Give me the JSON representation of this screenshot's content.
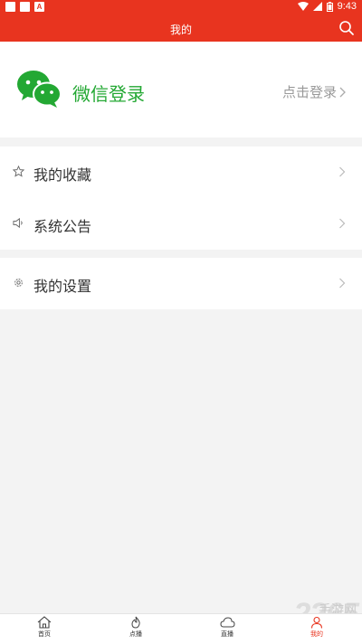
{
  "status_bar": {
    "time": "9:43",
    "notif_badge": "A"
  },
  "header": {
    "title": "我的"
  },
  "login": {
    "wechat_label": "微信登录",
    "login_link": "点击登录"
  },
  "menu": {
    "favorites": "我的收藏",
    "announcements": "系统公告",
    "settings": "我的设置"
  },
  "tabs": [
    {
      "label": "首页"
    },
    {
      "label": "点播"
    },
    {
      "label": "直播"
    },
    {
      "label": "我的"
    }
  ],
  "watermark": {
    "number": "2265",
    "text": "手游网"
  },
  "colors": {
    "primary": "#e8341f",
    "wechat": "#23a833",
    "background": "#f3f3f3"
  }
}
